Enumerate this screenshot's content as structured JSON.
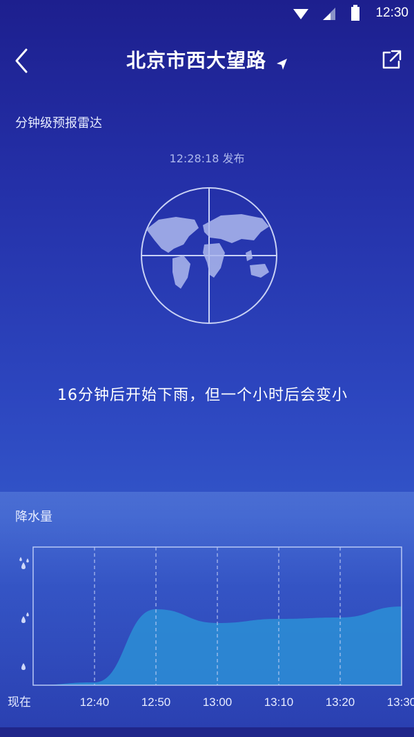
{
  "status_bar": {
    "time": "12:30"
  },
  "header": {
    "title": "北京市西大望路"
  },
  "radar_section": {
    "title": "分钟级预报雷达",
    "published": "12:28:18 发布",
    "forecast": "16分钟后开始下雨，但一个小时后会变小"
  },
  "precip_section": {
    "title": "降水量"
  },
  "chart_data": {
    "type": "area",
    "title": "",
    "xlabel": "",
    "ylabel": "",
    "x": [
      "现在",
      "12:40",
      "12:50",
      "13:00",
      "13:10",
      "13:20",
      "13:30"
    ],
    "values": [
      0,
      0.02,
      0.55,
      0.45,
      0.48,
      0.49,
      0.57
    ],
    "ylim": [
      0,
      1
    ],
    "grid": true,
    "colors": {
      "fill": "#2c8fd6",
      "frame": "#b8c8f5"
    }
  },
  "icons": [
    "back-icon",
    "location-arrow-icon",
    "share-icon",
    "wifi-icon",
    "signal-icon",
    "battery-icon",
    "globe-icon",
    "raindrop-icon"
  ]
}
